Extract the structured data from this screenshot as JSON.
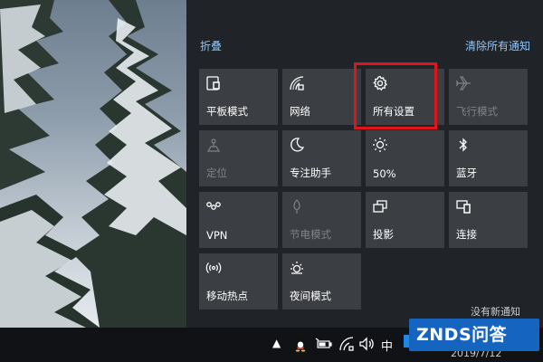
{
  "header": {
    "collapse_label": "折叠",
    "clear_all_label": "清除所有通知"
  },
  "tiles": [
    {
      "label": "平板模式",
      "icon": "tablet-mode-icon",
      "enabled": true
    },
    {
      "label": "网络",
      "icon": "network-icon",
      "enabled": true
    },
    {
      "label": "所有设置",
      "icon": "gear-icon",
      "enabled": true,
      "highlighted": true
    },
    {
      "label": "飞行模式",
      "icon": "airplane-icon",
      "enabled": false
    },
    {
      "label": "定位",
      "icon": "location-icon",
      "enabled": false
    },
    {
      "label": "专注助手",
      "icon": "moon-icon",
      "enabled": true
    },
    {
      "label": "50%",
      "icon": "brightness-icon",
      "enabled": true
    },
    {
      "label": "蓝牙",
      "icon": "bluetooth-icon",
      "enabled": true
    },
    {
      "label": "VPN",
      "icon": "vpn-icon",
      "enabled": true
    },
    {
      "label": "节电模式",
      "icon": "battery-saver-icon",
      "enabled": false
    },
    {
      "label": "投影",
      "icon": "project-icon",
      "enabled": true
    },
    {
      "label": "连接",
      "icon": "connect-icon",
      "enabled": true
    },
    {
      "label": "移动热点",
      "icon": "mobile-hotspot-icon",
      "enabled": true
    },
    {
      "label": "夜间模式",
      "icon": "night-light-icon",
      "enabled": true
    }
  ],
  "taskbar": {
    "ime_label": "中",
    "date_text": "2019/7/12",
    "toast_text": "没有新通知"
  },
  "watermark": {
    "text": "ZNDS问答"
  },
  "colors": {
    "accent": "#8ec5ff",
    "tile_bg": "#3b3e43",
    "highlight": "#e0141b"
  }
}
